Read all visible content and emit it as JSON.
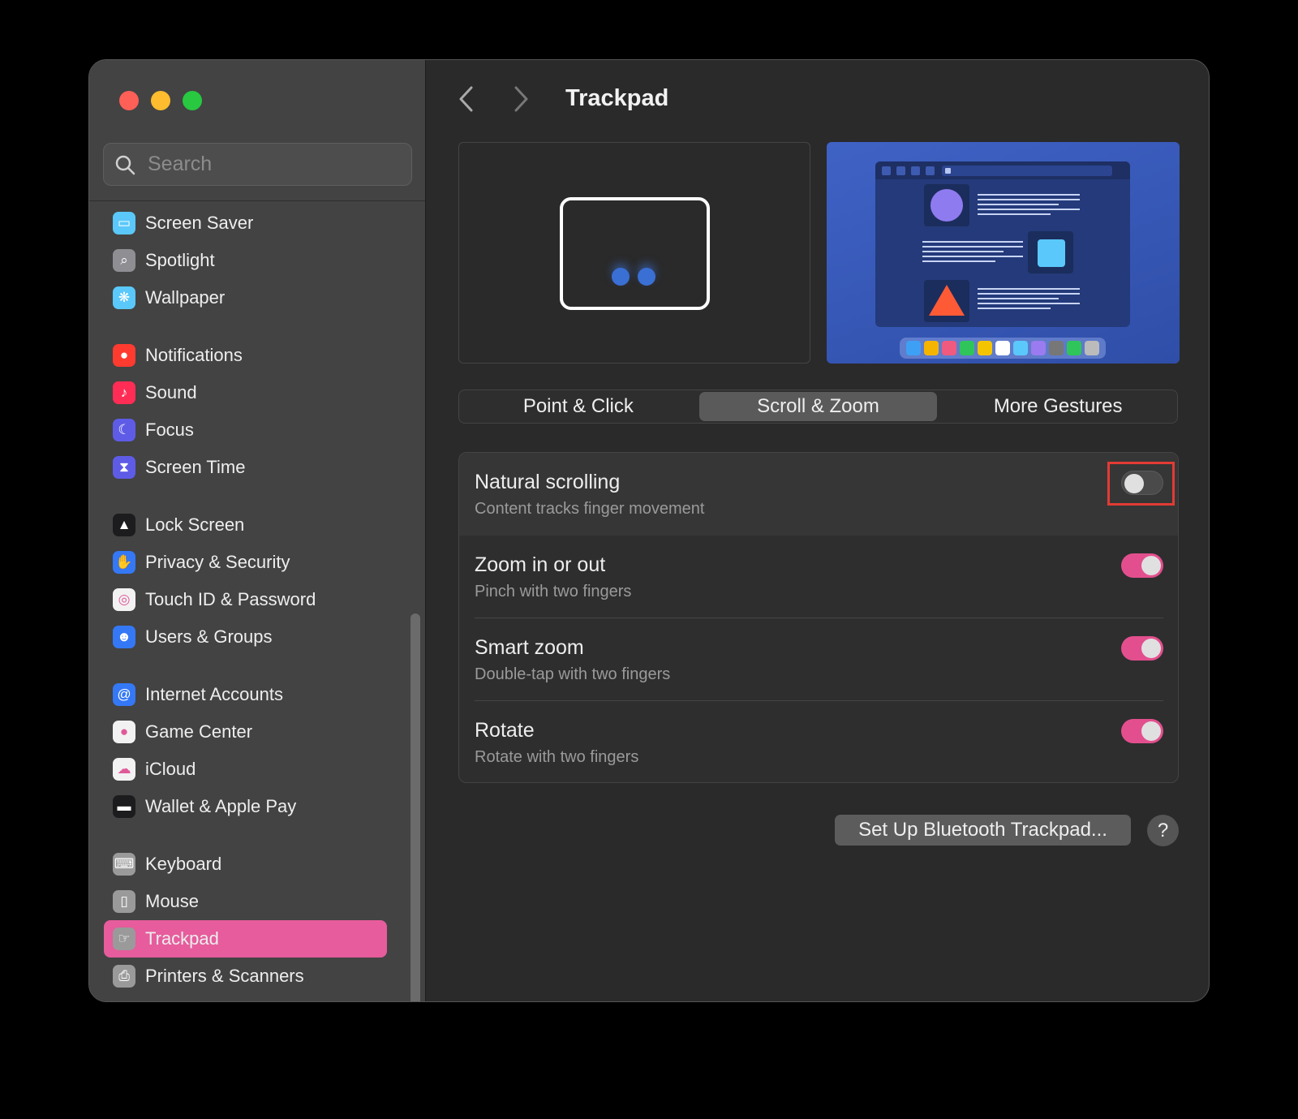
{
  "window": {
    "title": "Trackpad"
  },
  "search": {
    "placeholder": "Search"
  },
  "sidebar": {
    "items": [
      {
        "label": "Screen Saver",
        "icon": "screen-saver-icon",
        "color": "#5ac8fa"
      },
      {
        "label": "Spotlight",
        "icon": "spotlight-icon",
        "color": "#8e8e93"
      },
      {
        "label": "Wallpaper",
        "icon": "wallpaper-icon",
        "color": "#5ac8fa"
      },
      {
        "label": "Notifications",
        "icon": "notifications-icon",
        "color": "#ff3b30"
      },
      {
        "label": "Sound",
        "icon": "sound-icon",
        "color": "#ff2d55"
      },
      {
        "label": "Focus",
        "icon": "focus-icon",
        "color": "#5e5ce6"
      },
      {
        "label": "Screen Time",
        "icon": "screen-time-icon",
        "color": "#5e5ce6"
      },
      {
        "label": "Lock Screen",
        "icon": "lock-screen-icon",
        "color": "#1c1c1e"
      },
      {
        "label": "Privacy & Security",
        "icon": "privacy-hand-icon",
        "color": "#3478f6"
      },
      {
        "label": "Touch ID & Password",
        "icon": "fingerprint-icon",
        "color": "#f2f2f2"
      },
      {
        "label": "Users & Groups",
        "icon": "users-icon",
        "color": "#3478f6"
      },
      {
        "label": "Internet Accounts",
        "icon": "at-sign-icon",
        "color": "#3478f6"
      },
      {
        "label": "Game Center",
        "icon": "game-center-icon",
        "color": "#f2f2f2"
      },
      {
        "label": "iCloud",
        "icon": "icloud-icon",
        "color": "#f2f2f2"
      },
      {
        "label": "Wallet & Apple Pay",
        "icon": "wallet-icon",
        "color": "#1c1c1e"
      },
      {
        "label": "Keyboard",
        "icon": "keyboard-icon",
        "color": "#9a9a9a"
      },
      {
        "label": "Mouse",
        "icon": "mouse-icon",
        "color": "#9a9a9a"
      },
      {
        "label": "Trackpad",
        "icon": "trackpad-icon",
        "color": "#9a9a9a",
        "active": true
      },
      {
        "label": "Printers & Scanners",
        "icon": "printer-icon",
        "color": "#9a9a9a"
      }
    ]
  },
  "tabs": [
    {
      "label": "Point & Click",
      "selected": false
    },
    {
      "label": "Scroll & Zoom",
      "selected": true
    },
    {
      "label": "More Gestures",
      "selected": false
    }
  ],
  "settings": [
    {
      "title": "Natural scrolling",
      "subtitle": "Content tracks finger movement",
      "enabled": false
    },
    {
      "title": "Zoom in or out",
      "subtitle": "Pinch with two fingers",
      "enabled": true
    },
    {
      "title": "Smart zoom",
      "subtitle": "Double-tap with two fingers",
      "enabled": true
    },
    {
      "title": "Rotate",
      "subtitle": "Rotate with two fingers",
      "enabled": true
    }
  ],
  "footer": {
    "bluetooth_button": "Set Up Bluetooth Trackpad...",
    "help_button": "?"
  },
  "colors": {
    "accent": "#e65c9c",
    "toggle_on": "#e34f8e",
    "highlight_box": "#e23b34"
  }
}
